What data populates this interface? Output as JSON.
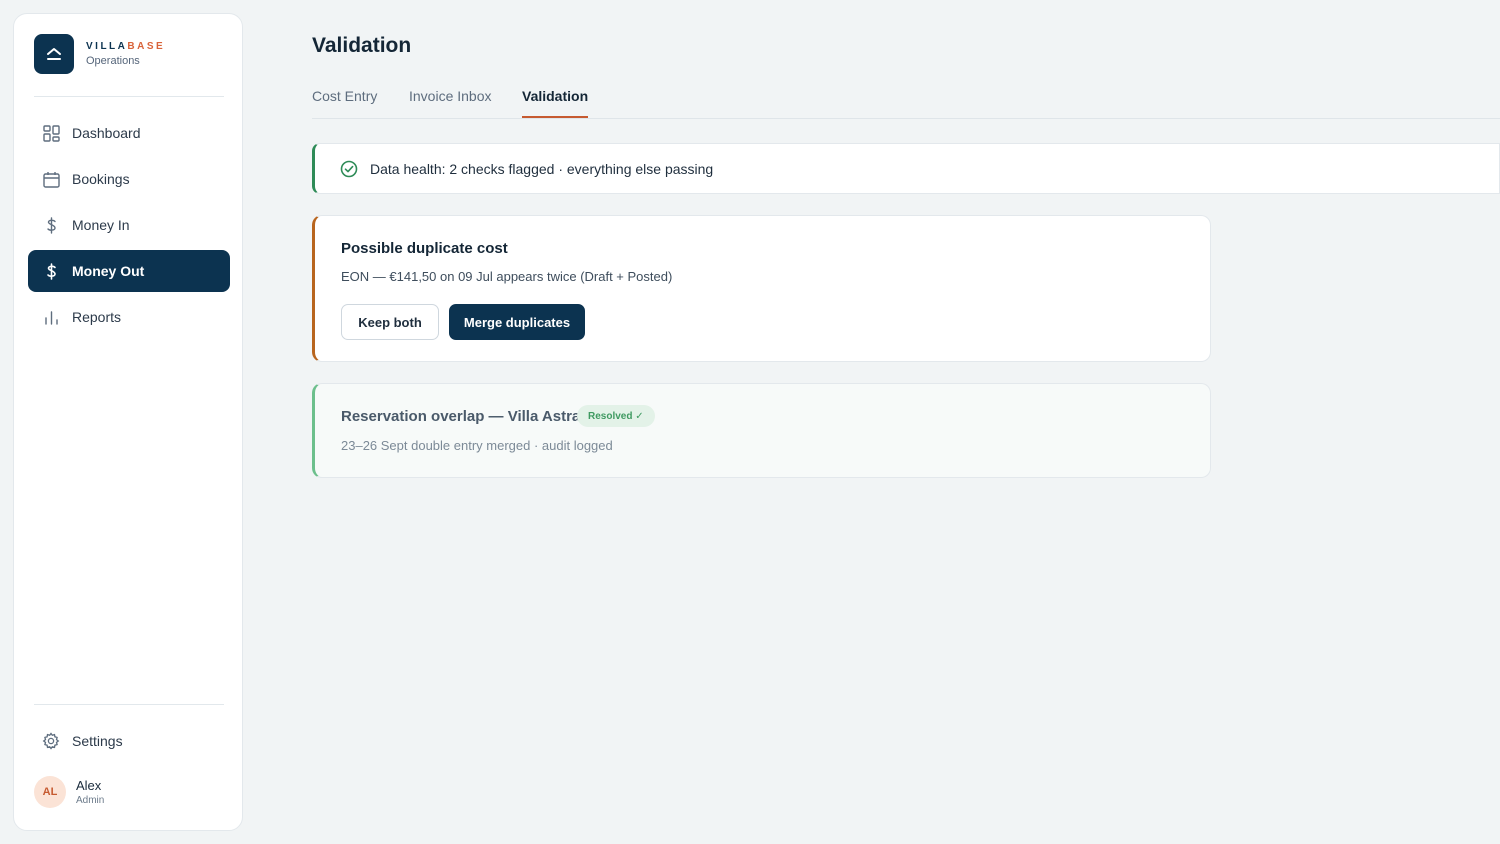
{
  "brand": {
    "name_main": "VILLA",
    "name_accent": "BASE",
    "subtitle": "Operations"
  },
  "nav": [
    {
      "label": "Dashboard",
      "icon": "grid-icon"
    },
    {
      "label": "Bookings",
      "icon": "calendar-icon"
    },
    {
      "label": "Money In",
      "icon": "dollar-icon"
    },
    {
      "label": "Money Out",
      "icon": "dollar-icon",
      "active": true
    },
    {
      "label": "Reports",
      "icon": "bar-chart-icon"
    }
  ],
  "settings_label": "Settings",
  "user": {
    "initials": "AL",
    "name": "Alex",
    "role": "Admin"
  },
  "page": {
    "title": "Validation"
  },
  "tabs": [
    {
      "label": "Cost Entry"
    },
    {
      "label": "Invoice Inbox"
    },
    {
      "label": "Validation",
      "active": true
    }
  ],
  "health": {
    "text": "Data health: 2 checks flagged · everything else passing"
  },
  "duplicate_card": {
    "title": "Possible duplicate cost",
    "description": "EON — €141,50 on 09 Jul appears twice (Draft + Posted)",
    "keep_label": "Keep both",
    "merge_label": "Merge duplicates"
  },
  "overlap_card": {
    "title": "Reservation overlap — Villa Astra",
    "badge": "Resolved ✓",
    "description": "23–26 Sept double entry merged · audit logged"
  },
  "colors": {
    "primary": "#0c3350",
    "accent": "#d9633a",
    "success": "#2e8b57",
    "warning": "#b8651e"
  }
}
